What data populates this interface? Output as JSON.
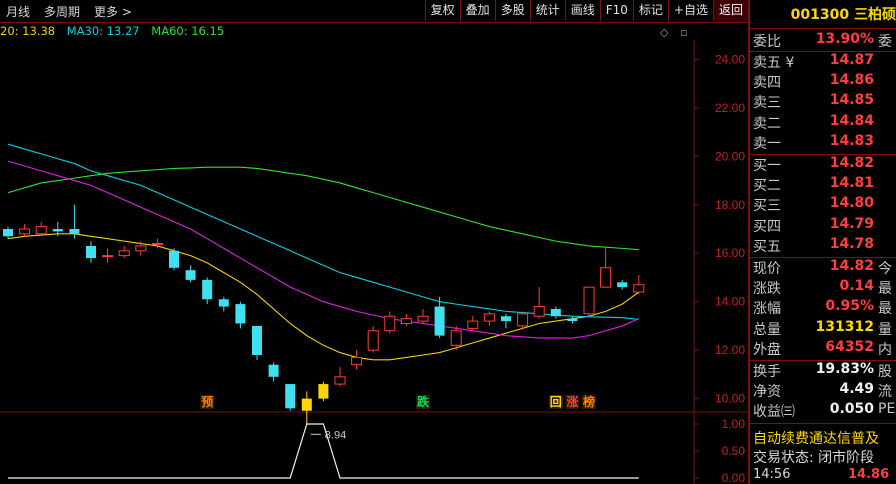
{
  "toolbar": {
    "left_tabs": [
      "月线",
      "多周期",
      "更多 >"
    ],
    "right_buttons": [
      "复权",
      "叠加",
      "多股",
      "统计",
      "画线",
      "F10",
      "标记",
      "+自选",
      "返回"
    ]
  },
  "ma_legend": [
    {
      "label": "20: 13.38",
      "color": "#f0d000"
    },
    {
      "label": "MA30: 13.27",
      "color": "#00d0e0"
    },
    {
      "label": "MA60: 16.15",
      "color": "#30e030"
    }
  ],
  "chart_controls": [
    "◇",
    "▫"
  ],
  "chart_data": {
    "type": "candlestick",
    "y_axis_ticks": [
      10.0,
      12.0,
      14.0,
      16.0,
      18.0,
      20.0,
      22.0,
      24.0
    ],
    "ylim": [
      9.2,
      24.8
    ],
    "candles": [
      {
        "o": 17.0,
        "c": 16.7,
        "h": 17.1,
        "l": 16.6
      },
      {
        "o": 16.8,
        "c": 17.0,
        "h": 17.2,
        "l": 16.7
      },
      {
        "o": 16.8,
        "c": 17.1,
        "h": 17.3,
        "l": 16.7
      },
      {
        "o": 17.0,
        "c": 16.9,
        "h": 17.3,
        "l": 16.7
      },
      {
        "o": 17.0,
        "c": 16.8,
        "h": 18.0,
        "l": 16.6
      },
      {
        "o": 16.3,
        "c": 15.8,
        "h": 16.5,
        "l": 15.6
      },
      {
        "o": 15.9,
        "c": 15.9,
        "h": 16.2,
        "l": 15.6
      },
      {
        "o": 15.9,
        "c": 16.1,
        "h": 16.3,
        "l": 15.8
      },
      {
        "o": 16.1,
        "c": 16.3,
        "h": 16.5,
        "l": 15.9
      },
      {
        "o": 16.4,
        "c": 16.4,
        "h": 16.6,
        "l": 16.2
      },
      {
        "o": 16.1,
        "c": 15.4,
        "h": 16.2,
        "l": 15.3
      },
      {
        "o": 15.3,
        "c": 14.9,
        "h": 15.5,
        "l": 14.8
      },
      {
        "o": 14.9,
        "c": 14.1,
        "h": 15.0,
        "l": 13.9
      },
      {
        "o": 14.1,
        "c": 13.8,
        "h": 14.2,
        "l": 13.6
      },
      {
        "o": 13.9,
        "c": 13.1,
        "h": 14.0,
        "l": 12.9
      },
      {
        "o": 13.0,
        "c": 11.8,
        "h": 13.0,
        "l": 11.6
      },
      {
        "o": 11.4,
        "c": 10.9,
        "h": 11.5,
        "l": 10.7
      },
      {
        "o": 10.6,
        "c": 9.6,
        "h": 10.6,
        "l": 9.5
      },
      {
        "o": 9.5,
        "c": 10.0,
        "h": 10.3,
        "l": 8.94,
        "hl": true
      },
      {
        "o": 10.0,
        "c": 10.6,
        "h": 10.7,
        "l": 9.9,
        "hl": true
      },
      {
        "o": 10.6,
        "c": 10.9,
        "h": 11.3,
        "l": 10.5
      },
      {
        "o": 11.4,
        "c": 11.7,
        "h": 12.0,
        "l": 11.2
      },
      {
        "o": 12.0,
        "c": 12.8,
        "h": 13.0,
        "l": 11.9
      },
      {
        "o": 12.8,
        "c": 13.4,
        "h": 13.6,
        "l": 12.7
      },
      {
        "o": 13.1,
        "c": 13.3,
        "h": 13.5,
        "l": 13.0
      },
      {
        "o": 13.2,
        "c": 13.4,
        "h": 13.7,
        "l": 13.1
      },
      {
        "o": 13.8,
        "c": 12.6,
        "h": 14.2,
        "l": 12.5
      },
      {
        "o": 12.2,
        "c": 12.8,
        "h": 13.0,
        "l": 12.0
      },
      {
        "o": 12.9,
        "c": 13.2,
        "h": 13.4,
        "l": 12.8
      },
      {
        "o": 13.2,
        "c": 13.5,
        "h": 13.6,
        "l": 13.0
      },
      {
        "o": 13.4,
        "c": 13.2,
        "h": 13.5,
        "l": 12.9
      },
      {
        "o": 13.0,
        "c": 13.5,
        "h": 13.6,
        "l": 12.9
      },
      {
        "o": 13.4,
        "c": 13.8,
        "h": 14.6,
        "l": 13.3
      },
      {
        "o": 13.7,
        "c": 13.4,
        "h": 13.8,
        "l": 13.3
      },
      {
        "o": 13.3,
        "c": 13.2,
        "h": 13.4,
        "l": 13.1
      },
      {
        "o": 13.5,
        "c": 14.6,
        "h": 14.6,
        "l": 13.4
      },
      {
        "o": 14.6,
        "c": 15.4,
        "h": 16.2,
        "l": 14.6
      },
      {
        "o": 14.8,
        "c": 14.6,
        "h": 14.9,
        "l": 14.5
      },
      {
        "o": 14.4,
        "c": 14.7,
        "h": 15.1,
        "l": 14.3
      }
    ],
    "ma_lines": [
      {
        "name": "MA20",
        "color": "#f0d000",
        "values": [
          16.6,
          16.7,
          16.75,
          16.8,
          16.8,
          16.7,
          16.6,
          16.5,
          16.4,
          16.3,
          16.1,
          15.9,
          15.6,
          15.2,
          14.8,
          14.3,
          13.7,
          13.1,
          12.6,
          12.2,
          11.9,
          11.7,
          11.6,
          11.6,
          11.7,
          11.8,
          11.9,
          12.1,
          12.3,
          12.5,
          12.7,
          12.9,
          13.1,
          13.2,
          13.3,
          13.4,
          13.6,
          13.9,
          14.4
        ]
      },
      {
        "name": "MA30",
        "color": "#00d0e0",
        "values": [
          20.5,
          20.3,
          20.1,
          19.9,
          19.7,
          19.4,
          19.2,
          19.0,
          18.8,
          18.5,
          18.2,
          17.9,
          17.6,
          17.3,
          17.0,
          16.7,
          16.4,
          16.1,
          15.8,
          15.5,
          15.2,
          15.0,
          14.8,
          14.6,
          14.4,
          14.2,
          14.0,
          13.9,
          13.8,
          13.7,
          13.6,
          13.55,
          13.5,
          13.45,
          13.4,
          13.38,
          13.36,
          13.34,
          13.27
        ]
      },
      {
        "name": "MA60",
        "color": "#30e030",
        "values": [
          18.5,
          18.7,
          18.9,
          19.0,
          19.1,
          19.2,
          19.3,
          19.35,
          19.4,
          19.45,
          19.5,
          19.52,
          19.55,
          19.55,
          19.55,
          19.5,
          19.4,
          19.3,
          19.2,
          19.05,
          18.9,
          18.7,
          18.5,
          18.3,
          18.1,
          17.9,
          17.7,
          17.5,
          17.3,
          17.1,
          16.95,
          16.8,
          16.65,
          16.5,
          16.4,
          16.3,
          16.25,
          16.2,
          16.15
        ]
      },
      {
        "name": "MA-M",
        "color": "#e020e0",
        "values": [
          19.8,
          19.6,
          19.4,
          19.2,
          19.0,
          18.8,
          18.5,
          18.2,
          17.9,
          17.6,
          17.3,
          17.0,
          16.6,
          16.2,
          15.8,
          15.4,
          15.0,
          14.6,
          14.3,
          14.0,
          13.8,
          13.6,
          13.45,
          13.3,
          13.2,
          13.1,
          13.0,
          12.9,
          12.8,
          12.7,
          12.6,
          12.55,
          12.5,
          12.5,
          12.5,
          12.6,
          12.8,
          13.0,
          13.3
        ]
      }
    ],
    "low_marker": "8.94",
    "signals": [
      {
        "label": "预",
        "index": 12
      },
      {
        "label": "跌",
        "index": 25
      },
      {
        "label": "回",
        "index": 33
      },
      {
        "label": "涨",
        "index": 34
      },
      {
        "label": "榜",
        "index": 35
      }
    ],
    "sub_axis_ticks": [
      1.0,
      0.5,
      0.0
    ],
    "sub_line": {
      "ylim": [
        0,
        1
      ],
      "values": [
        0,
        0,
        0,
        0,
        0,
        0,
        0,
        0,
        0,
        0,
        0,
        0,
        0,
        0,
        0,
        0,
        0,
        0,
        1,
        1,
        0,
        0,
        0,
        0,
        0,
        0,
        0,
        0,
        0,
        0,
        0,
        0,
        0,
        0,
        0,
        0,
        0,
        0,
        0
      ]
    }
  },
  "stock": {
    "code_name": "001300 三柏硕",
    "weibi_label": "委比",
    "weibi_value": "13.90%",
    "weibi_tail": "委",
    "sell": [
      {
        "label": "卖五 ¥",
        "price": "14.87"
      },
      {
        "label": "卖四",
        "price": "14.86"
      },
      {
        "label": "卖三",
        "price": "14.85"
      },
      {
        "label": "卖二",
        "price": "14.84"
      },
      {
        "label": "卖一",
        "price": "14.83"
      }
    ],
    "buy": [
      {
        "label": "买一",
        "price": "14.82"
      },
      {
        "label": "买二",
        "price": "14.81"
      },
      {
        "label": "买三",
        "price": "14.80"
      },
      {
        "label": "买四",
        "price": "14.79"
      },
      {
        "label": "买五",
        "price": "14.78"
      }
    ],
    "stats": [
      {
        "label": "现价",
        "value": "14.82",
        "tail": "今",
        "color": "red"
      },
      {
        "label": "涨跌",
        "value": "0.14",
        "tail": "最",
        "color": "red"
      },
      {
        "label": "涨幅",
        "value": "0.95%",
        "tail": "最",
        "color": "red"
      },
      {
        "label": "总量",
        "value": "131312",
        "tail": "量",
        "color": "yellow"
      },
      {
        "label": "外盘",
        "value": "64352",
        "tail": "内",
        "color": "red"
      }
    ],
    "stats2": [
      {
        "label": "换手",
        "value": "19.83%",
        "tail": "股",
        "color": "white"
      },
      {
        "label": "净资",
        "value": "4.49",
        "tail": "流",
        "color": "white"
      },
      {
        "label": "收益㈢",
        "value": "0.050",
        "tail": "PE",
        "color": "white"
      }
    ],
    "notice": "自动续费通达信普及",
    "status": "交易状态: 闭市阶段",
    "last_tick_time": "14:56",
    "last_tick_price": "14.86"
  }
}
